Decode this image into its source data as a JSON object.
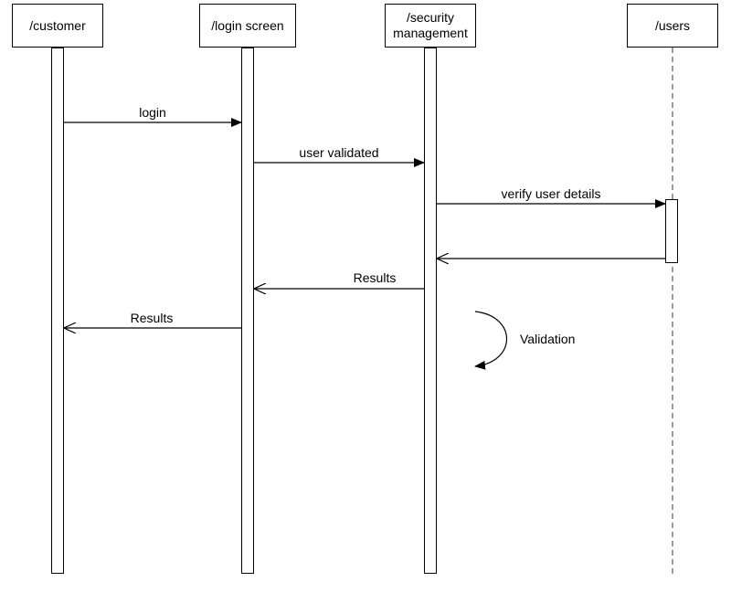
{
  "participants": {
    "customer": {
      "label": "/customer"
    },
    "login_screen": {
      "label": "/login screen"
    },
    "security_mgmt": {
      "label": "/security management"
    },
    "users": {
      "label": "/users"
    }
  },
  "messages": {
    "login": "login",
    "user_validated": "user validated",
    "verify_user_details": "verify user details",
    "results_to_login": "Results",
    "results_to_customer": "Results",
    "validation": "Validation"
  },
  "chart_data": {
    "type": "sequence-diagram",
    "participants": [
      "/customer",
      "/login screen",
      "/security management",
      "/users"
    ],
    "interactions": [
      {
        "from": "/customer",
        "to": "/login screen",
        "label": "login",
        "kind": "sync"
      },
      {
        "from": "/login screen",
        "to": "/security management",
        "label": "user validated",
        "kind": "sync"
      },
      {
        "from": "/security management",
        "to": "/users",
        "label": "verify user details",
        "kind": "sync"
      },
      {
        "from": "/users",
        "to": "/security management",
        "label": "",
        "kind": "return"
      },
      {
        "from": "/security management",
        "to": "/login screen",
        "label": "Results",
        "kind": "return"
      },
      {
        "from": "/login screen",
        "to": "/customer",
        "label": "Results",
        "kind": "return"
      },
      {
        "from": "/security management",
        "to": "/security management",
        "label": "Validation",
        "kind": "self"
      }
    ]
  }
}
